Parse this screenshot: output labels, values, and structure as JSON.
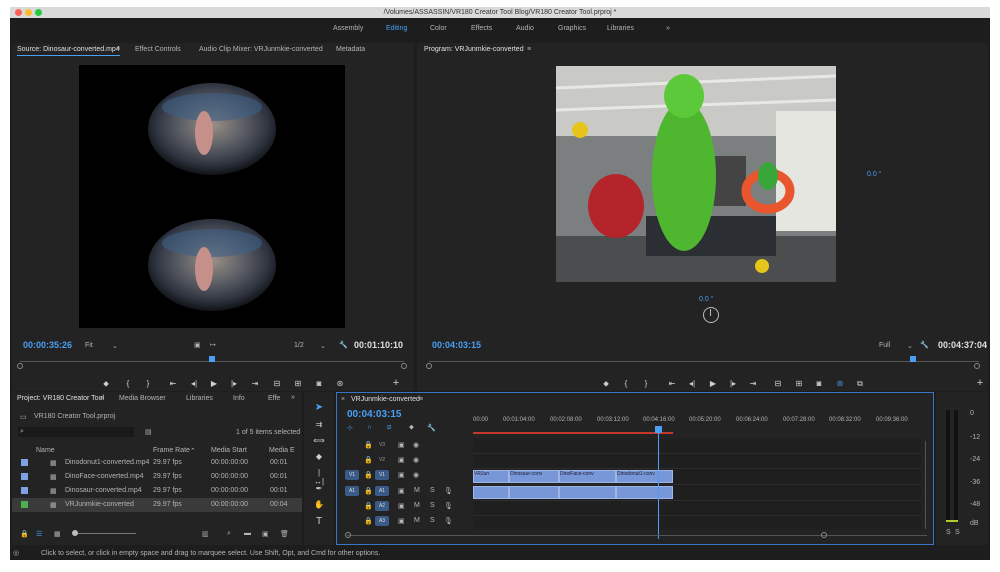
{
  "window": {
    "title": "/Volumes/ASSASSIN/VR180 Creator Tool Blog/VR180 Creator Tool.prproj *"
  },
  "workspaces": [
    "Assembly",
    "Editing",
    "Color",
    "Effects",
    "Audio",
    "Graphics",
    "Libraries"
  ],
  "workspaces_more": "»",
  "source": {
    "tabs": [
      "Source: Dinosaur-converted.mp4",
      "Effect Controls",
      "Audio Clip Mixer: VRJunmkie-converted",
      "Metadata"
    ],
    "timecode": "00:00:35:26",
    "fit": "Fit",
    "resolution": "1/2",
    "duration": "00:01:10:10",
    "playhead_fraction": 0.5
  },
  "program": {
    "tab": "Program: VRJunmkie-converted",
    "timecode": "00:04:03:15",
    "zoom": "Full",
    "duration": "00:04:37:04",
    "angle_right": "0.0 °",
    "angle_bottom": "0.0 °",
    "playhead_fraction": 0.88
  },
  "project": {
    "tabs": [
      "Project: VR180 Creator Tool",
      "Media Browser",
      "Libraries",
      "Info",
      "Effe"
    ],
    "file": "VR180 Creator Tool.prproj",
    "selection": "1 of 5 items selected",
    "columns": [
      "Name",
      "Frame Rate",
      "Media Start",
      "Media E"
    ],
    "rows": [
      {
        "name": "Dinodonut1-converted.mp4",
        "fps": "29.97 fps",
        "start": "00:00:00:00",
        "end": "00:01",
        "color": "#7ea1e6"
      },
      {
        "name": "DinoFace-converted.mp4",
        "fps": "29.97 fps",
        "start": "00:00:00:00",
        "end": "00:01",
        "color": "#7ea1e6"
      },
      {
        "name": "Dinosaur-converted.mp4",
        "fps": "29.97 fps",
        "start": "00:00:00:00",
        "end": "00:01",
        "color": "#7ea1e6"
      },
      {
        "name": "VRJunmkie-converted",
        "fps": "29.97 fps",
        "start": "00:00:00:00",
        "end": "00:04",
        "color": "#4caf50"
      }
    ]
  },
  "timeline": {
    "tab": "VRJunmkie-converted",
    "timecode": "00:04:03:15",
    "ruler": [
      "00:00",
      "00:01:04:00",
      "00:02:08:00",
      "00:03:12:00",
      "00:04:16:00",
      "00:05:20:00",
      "00:06:24:00",
      "00:07:28:00",
      "00:08:32:00",
      "00:09:36:00"
    ],
    "video_tracks": [
      "V3",
      "V2",
      "V1"
    ],
    "audio_tracks": [
      "A1",
      "A2",
      "A3"
    ],
    "source_patch_v": "V1",
    "source_patch_a": "A1",
    "mute_label": "M",
    "solo_label": "S",
    "clips": [
      "VRJun",
      "Dinosaur-conv",
      "DinoFace-conv",
      "Dinodonut1-conv"
    ]
  },
  "meter": {
    "labels": [
      "0",
      "-12",
      "-24",
      "-36",
      "-48",
      "dB"
    ],
    "solo": [
      "S",
      "S"
    ]
  },
  "status_text": "Click to select, or click in empty space and drag to marquee select. Use Shift, Opt, and Cmd for other options."
}
